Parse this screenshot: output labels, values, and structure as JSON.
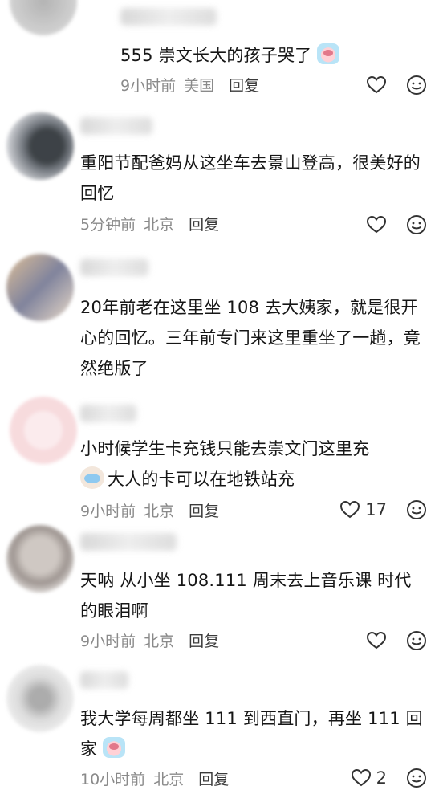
{
  "comments": [
    {
      "text": "555 崇文长大的孩子哭了",
      "time": "9小时前",
      "location": "美国",
      "reply": "回复",
      "likes": ""
    },
    {
      "text": "重阳节配爸妈从这坐车去景山登高，很美好的回忆",
      "time": "5分钟前",
      "location": "北京",
      "reply": "回复",
      "likes": ""
    },
    {
      "text": "20年前老在这里坐 108 去大姨家，就是很开心的回忆。三年前专门来这里重坐了一趟，竟然绝版了",
      "time": "",
      "location": "",
      "reply": "",
      "likes": ""
    },
    {
      "text_part1": "小时候学生卡充钱只能去崇文门这里充",
      "text_part2": "大人的卡可以在地铁站充",
      "time": "9小时前",
      "location": "北京",
      "reply": "回复",
      "likes": "17"
    },
    {
      "text": "天呐 从小坐 108.111 周末去上音乐课 时代的眼泪啊",
      "time": "9小时前",
      "location": "北京",
      "reply": "回复",
      "likes": ""
    },
    {
      "text": "我大学每周都坐 111 到西直门，再坐 111 回家",
      "time": "10小时前",
      "location": "北京",
      "reply": "回复",
      "likes": "2"
    }
  ],
  "icons": {
    "like": "heart-outline-icon",
    "emoji": "smiley-face-icon"
  }
}
